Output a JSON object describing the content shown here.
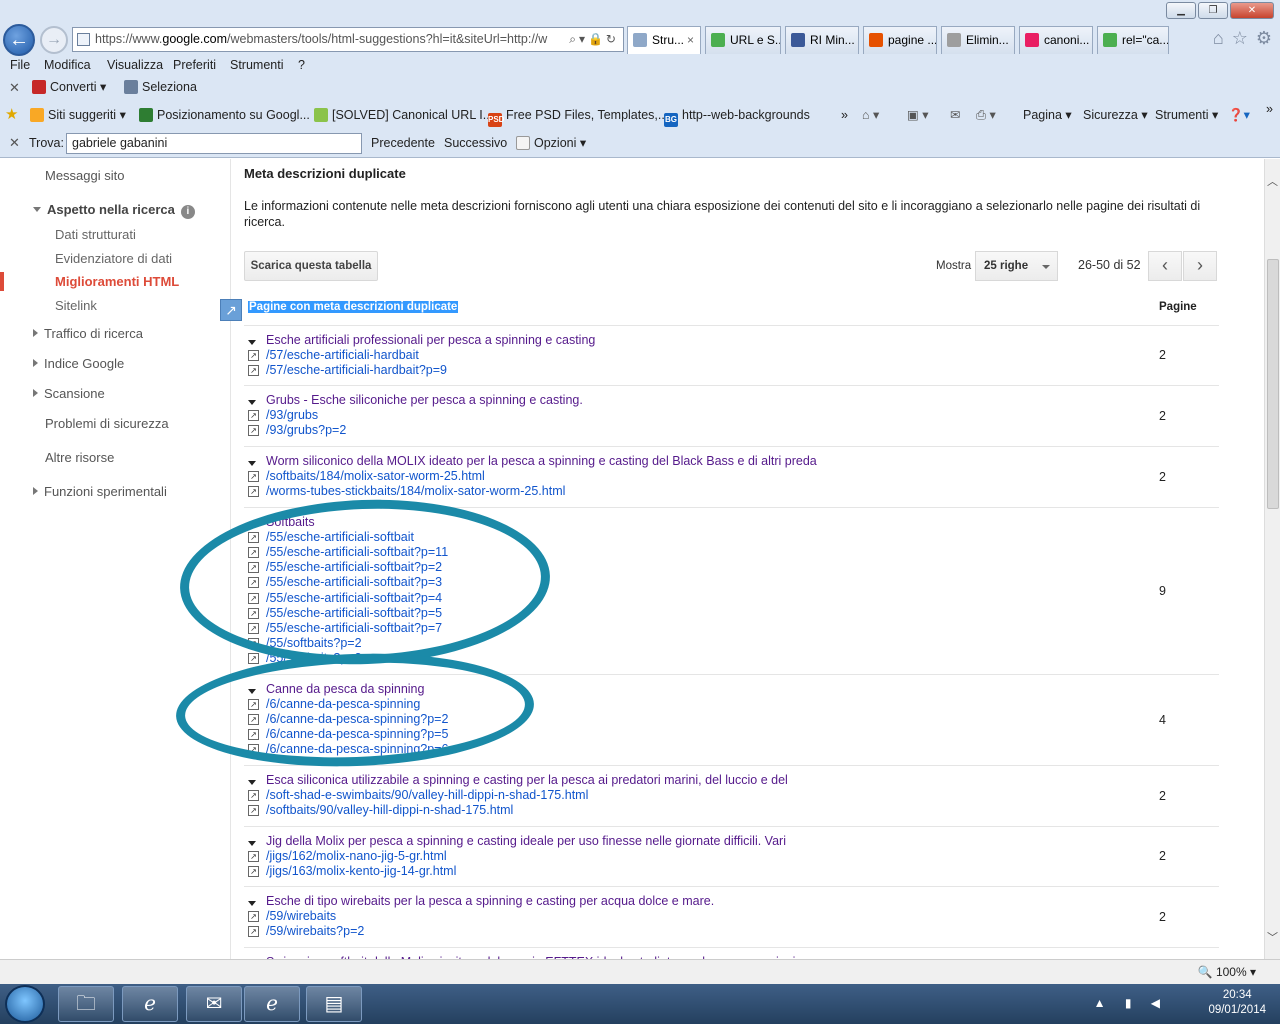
{
  "browser": {
    "address": {
      "prefix": "https://www.",
      "host": "google.com",
      "path": "/webmasters/tools/html-suggestions?hl=it&siteUrl=http://w"
    },
    "tabs": [
      {
        "label": "Stru...",
        "close": "×",
        "icon_color": "#8fa8c8"
      },
      {
        "label": "URL e S...",
        "icon_color": "#4caf50"
      },
      {
        "label": "RI Min...",
        "icon_color": "#3b5998"
      },
      {
        "label": "pagine ...",
        "icon_color": "#e65100"
      },
      {
        "label": "Elimin...",
        "icon_color": "#9e9e9e"
      },
      {
        "label": "canoni...",
        "icon_color": "#e91e63"
      },
      {
        "label": "rel=\"ca...",
        "icon_color": "#4caf50"
      }
    ],
    "menu": [
      "File",
      "Modifica",
      "Visualizza",
      "Preferiti",
      "Strumenti",
      "?"
    ],
    "cmd": {
      "convert": "Converti",
      "select": "Seleziona"
    },
    "favorites": [
      "Siti suggeriti",
      "Posizionamento su Googl...",
      "[SOLVED] Canonical URL I...",
      "Free PSD Files, Templates,...",
      "http--web-backgrounds"
    ],
    "fav_icons": {
      "psd": "PSD",
      "bg": "BG"
    },
    "ie_tools": {
      "page": "Pagina",
      "security": "Sicurezza",
      "tools": "Strumenti"
    },
    "find": {
      "label": "Trova:",
      "value": "gabriele gabanini",
      "prev": "Precedente",
      "next": "Successivo",
      "options": "Opzioni"
    },
    "zoom": "100%"
  },
  "sidebar": {
    "messages": "Messaggi sito",
    "search_appearance": "Aspetto nella ricerca",
    "info": "i",
    "items": [
      "Dati strutturati",
      "Evidenziatore di dati",
      "Miglioramenti HTML",
      "Sitelink"
    ],
    "sections": [
      "Traffico di ricerca",
      "Indice Google",
      "Scansione"
    ],
    "security": "Problemi di sicurezza",
    "resources": "Altre risorse",
    "labs": "Funzioni sperimentali"
  },
  "main": {
    "title": "Meta descrizioni duplicate",
    "description": "Le informazioni contenute nelle meta descrizioni forniscono agli utenti una chiara esposizione dei contenuti del sito e li incoraggiano a selezionarlo nelle pagine dei risultati di ricerca.",
    "download": "Scarica questa tabella",
    "show_label": "Mostra",
    "rows_select": "25 righe",
    "page_info": "26-50 di 52",
    "col_pages_header": "Pagine con meta descrizioni duplicate",
    "col_count_header": "Pagine",
    "groups": [
      {
        "title": "Esche artificiali professionali per pesca a spinning e casting",
        "count": "2",
        "urls": [
          "/57/esche-artificiali-hardbait",
          "/57/esche-artificiali-hardbait?p=9"
        ]
      },
      {
        "title": "Grubs - Esche siliconiche per pesca a spinning e casting.",
        "count": "2",
        "urls": [
          "/93/grubs",
          "/93/grubs?p=2"
        ]
      },
      {
        "title": "Worm siliconico della MOLIX ideato per la pesca a spinning e casting del Black Bass e di altri preda",
        "count": "2",
        "urls": [
          "/softbaits/184/molix-sator-worm-25.html",
          "/worms-tubes-stickbaits/184/molix-sator-worm-25.html"
        ]
      },
      {
        "title": "Softbaits",
        "count": "9",
        "urls": [
          "/55/esche-artificiali-softbait",
          "/55/esche-artificiali-softbait?p=11",
          "/55/esche-artificiali-softbait?p=2",
          "/55/esche-artificiali-softbait?p=3",
          "/55/esche-artificiali-softbait?p=4",
          "/55/esche-artificiali-softbait?p=5",
          "/55/esche-artificiali-softbait?p=7",
          "/55/softbaits?p=2",
          "/55/softbaits?p=3"
        ]
      },
      {
        "title": "Canne da pesca da spinning",
        "count": "4",
        "urls": [
          "/6/canne-da-pesca-spinning",
          "/6/canne-da-pesca-spinning?p=2",
          "/6/canne-da-pesca-spinning?p=5",
          "/6/canne-da-pesca-spinning?p=6"
        ]
      },
      {
        "title": "Esca siliconica utilizzabile a spinning e casting per la pesca ai predatori marini, del luccio e del",
        "count": "2",
        "urls": [
          "/soft-shad-e-swimbaits/90/valley-hill-dippi-n-shad-175.html",
          "/softbaits/90/valley-hill-dippi-n-shad-175.html"
        ]
      },
      {
        "title": "Jig della Molix per pesca a spinning e casting ideale per uso finesse nelle giornate difficili. Vari",
        "count": "2",
        "urls": [
          "/jigs/162/molix-nano-jig-5-gr.html",
          "/jigs/163/molix-kento-jig-14-gr.html"
        ]
      },
      {
        "title": "Esche di tipo wirebaits per la pesca a spinning e casting per acqua dolce e mare.",
        "count": "2",
        "urls": [
          "/59/wirebaits",
          "/59/wirebaits?p=2"
        ]
      },
      {
        "title": "Swimming softbait della Molix vincitore del premio EFTTEX ideale studiato per la pesca a spinning e",
        "count": "",
        "urls": []
      }
    ]
  },
  "annotation_color": "#1b8aa8",
  "taskbar": {
    "time": "20:34",
    "date": "09/01/2014"
  }
}
